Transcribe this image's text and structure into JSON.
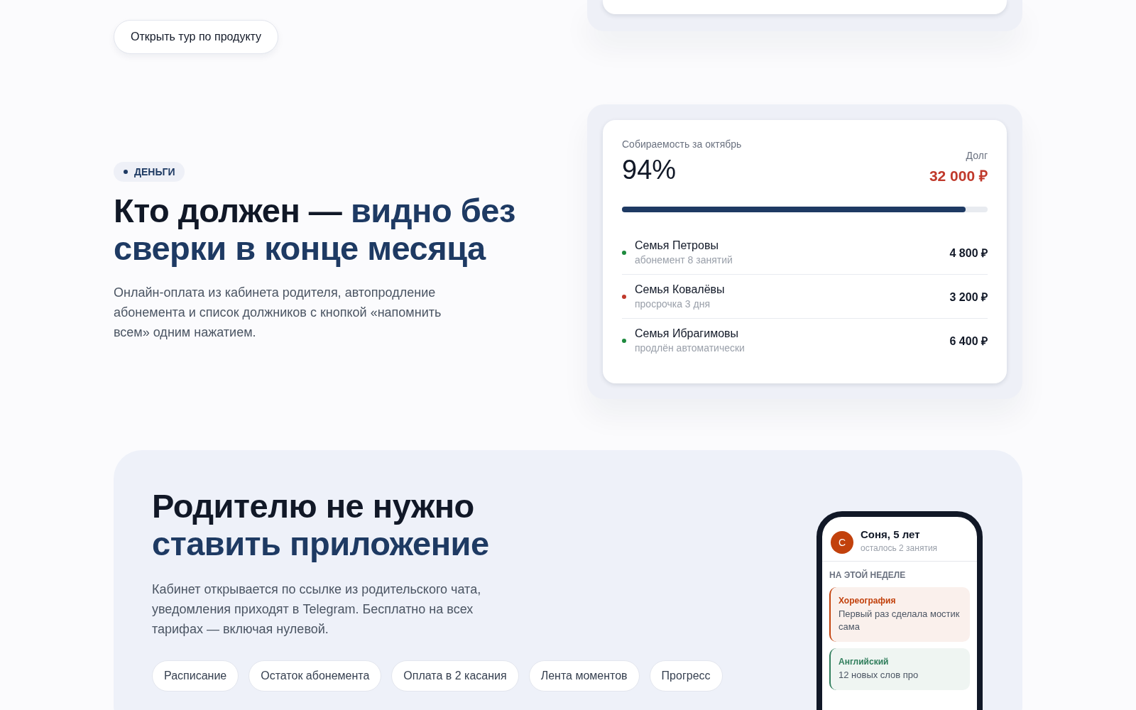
{
  "tour_button": "Открыть тур по продукту",
  "money": {
    "tag": "ДЕНЬГИ",
    "heading_dark": "Кто должен —",
    "heading_accent": "видно без сверки в конце месяца",
    "text": "Онлайн-оплата из кабинета родителя, автопродление абонемента и список должников с кнопкой «напомнить всем» одним нажатием.",
    "card": {
      "caption": "Собираемость за октябрь",
      "percent": "94%",
      "debt_label": "Долг",
      "debt": "32 000 ₽",
      "level": 0.94,
      "rows": [
        {
          "name": "Семья Петровы",
          "note": "абонемент 8 занятий",
          "amount": "4 800 ₽",
          "color": "#1e8a3e"
        },
        {
          "name": "Семья Ковалёвы",
          "note": "просрочка 3 дня",
          "amount": "3 200 ₽",
          "color": "#c0392b"
        },
        {
          "name": "Семья Ибрагимовы",
          "note": "продлён автоматически",
          "amount": "6 400 ₽",
          "color": "#1e8a3e"
        }
      ]
    }
  },
  "parents": {
    "heading_dark": "Родителю не нужно",
    "heading_accent": "ставить приложение",
    "text": "Кабинет открывается по ссылке из родительского чата, уведомления приходят в Telegram. Бесплатно на всех тарифах — включая нулевой.",
    "chips": [
      "Расписание",
      "Остаток абонемента",
      "Оплата в 2 касания",
      "Лента моментов",
      "Прогресс"
    ],
    "phone": {
      "avatar": "С",
      "child": "Соня, 5 лет",
      "remaining": "осталось 2 занятия",
      "week_label": "НА ЭТОЙ НЕДЕЛЕ",
      "cards": [
        {
          "title": "Хореография",
          "text": "Первый раз сделала мостик сама",
          "color": "#c2410c"
        },
        {
          "title": "Английский",
          "text": "12 новых слов про",
          "color": "#2f7d5b"
        }
      ]
    }
  }
}
